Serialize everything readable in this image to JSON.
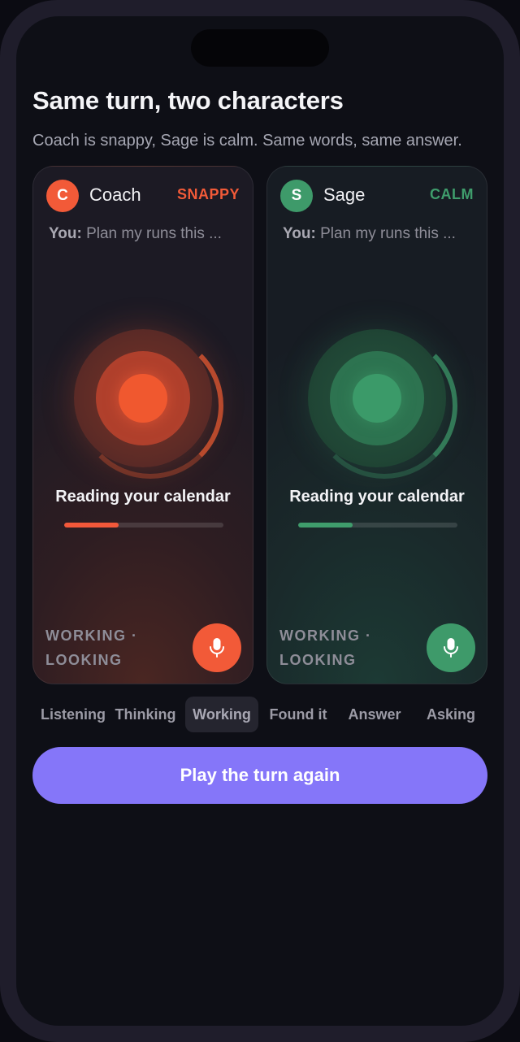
{
  "header": {
    "title": "Same turn, two characters",
    "subtitle": "Coach is snappy, Sage is calm. Same words, same answer."
  },
  "characters": [
    {
      "initial": "C",
      "name": "Coach",
      "mood": "SNAPPY",
      "you_label": "You:",
      "you_text": "Plan my runs this ...",
      "status": "Reading your calendar",
      "progress_fraction": 0.34,
      "state_line1": "WORKING ·",
      "state_line2": "LOOKING",
      "accent_color": "#f25a38",
      "mic_icon": "microphone-icon"
    },
    {
      "initial": "S",
      "name": "Sage",
      "mood": "CALM",
      "you_label": "You:",
      "you_text": "Plan my runs this ...",
      "status": "Reading your calendar",
      "progress_fraction": 0.34,
      "state_line1": "WORKING ·",
      "state_line2": "LOOKING",
      "accent_color": "#3e9a6a",
      "mic_icon": "microphone-icon"
    }
  ],
  "phases": [
    {
      "label": "Listening",
      "active": false
    },
    {
      "label": "Thinking",
      "active": false
    },
    {
      "label": "Working",
      "active": true
    },
    {
      "label": "Found it",
      "active": false
    },
    {
      "label": "Answer",
      "active": false
    },
    {
      "label": "Asking",
      "active": false
    }
  ],
  "actions": {
    "replay_label": "Play the turn again",
    "button_color": "#8576f9"
  }
}
